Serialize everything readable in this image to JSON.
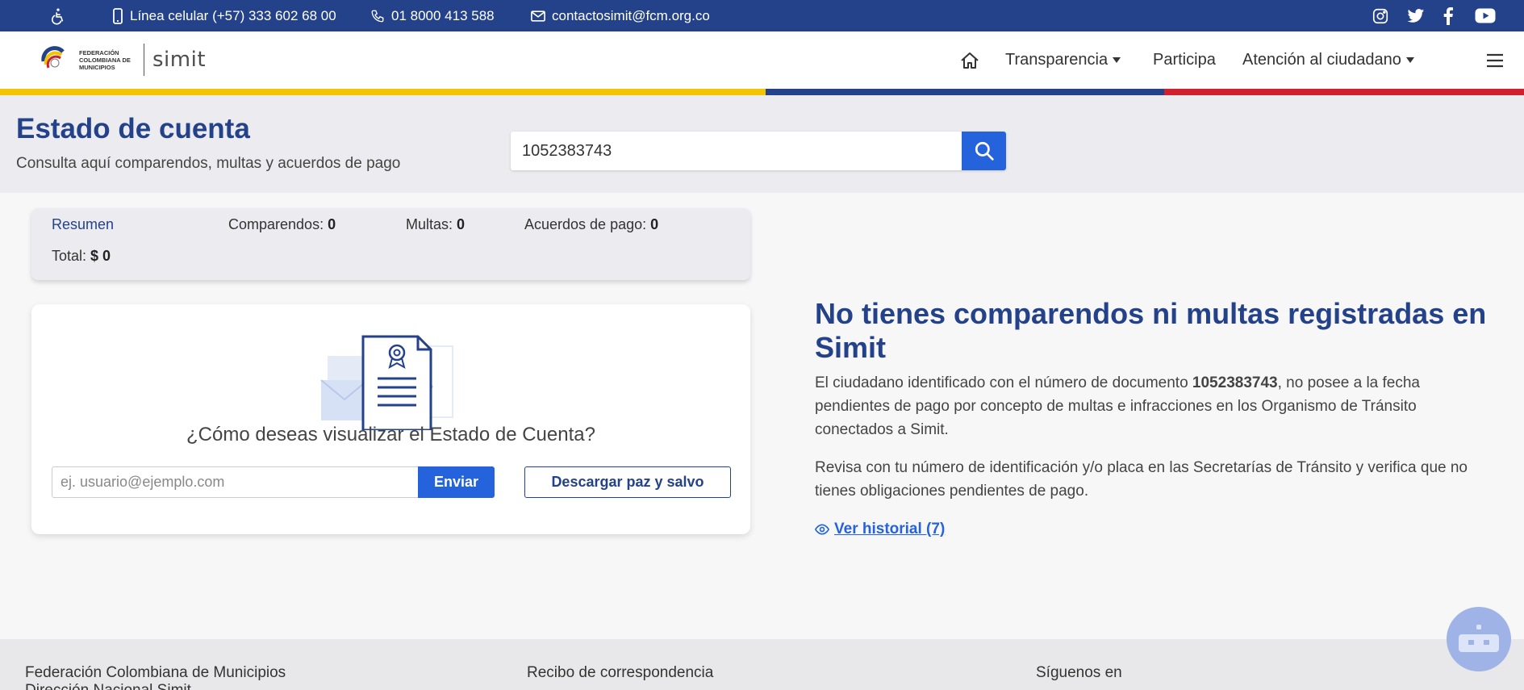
{
  "topbar": {
    "accessibility_icon": "accessibility-icon",
    "phone_mobile": "Línea celular (+57) 333 602 68 00",
    "phone_line": "01 8000 413 588",
    "email": "contactosimit@fcm.org.co",
    "social": [
      "instagram-icon",
      "twitter-icon",
      "facebook-icon",
      "youtube-icon"
    ]
  },
  "header": {
    "logo_text": "FEDERACIÓN COLOMBIANA DE MUNICIPIOS",
    "logo_brand": "simit",
    "nav": {
      "home_icon": "home-icon",
      "transparencia": "Transparencia",
      "participa": "Participa",
      "atencion": "Atención al ciudadano",
      "menu_icon": "hamburger-menu-icon"
    }
  },
  "hero": {
    "title": "Estado de cuenta",
    "subtitle": "Consulta aquí comparendos, multas y acuerdos de pago",
    "search_value": "1052383743",
    "search_icon": "search-icon"
  },
  "summary": {
    "label": "Resumen",
    "comparendos_label": "Comparendos:",
    "comparendos_value": "0",
    "multas_label": "Multas:",
    "multas_value": "0",
    "acuerdos_label": "Acuerdos de pago:",
    "acuerdos_value": "0",
    "total_label": "Total:",
    "total_value": "$ 0"
  },
  "download_card": {
    "illustration": "certificate-document-icon",
    "question": "¿Cómo deseas visualizar el Estado de Cuenta?",
    "email_placeholder": "ej. usuario@ejemplo.com",
    "send_label": "Enviar",
    "download_label": "Descargar paz y salvo"
  },
  "result": {
    "title": "No tienes comparendos ni multas registradas en Simit",
    "p1_before": "El ciudadano identificado con el número de documento ",
    "p1_doc": "1052383743",
    "p1_after": ", no posee a la fecha pendientes de pago por concepto de multas e infracciones en los Organismo de Tránsito conectados a Simit.",
    "p2": "Revisa con tu número de identificación y/o placa en las Secretarías de Tránsito y verifica que no tienes obligaciones pendientes de pago.",
    "history_link": "Ver historial (7)",
    "history_icon": "eye-icon"
  },
  "footer": {
    "col1_line1": "Federación Colombiana de Municipios",
    "col1_line2": "Dirección Nacional Simit",
    "col2": "Recibo de correspondencia",
    "col3": "Síguenos en"
  },
  "chatbot_icon": "chatbot-robot-icon"
}
